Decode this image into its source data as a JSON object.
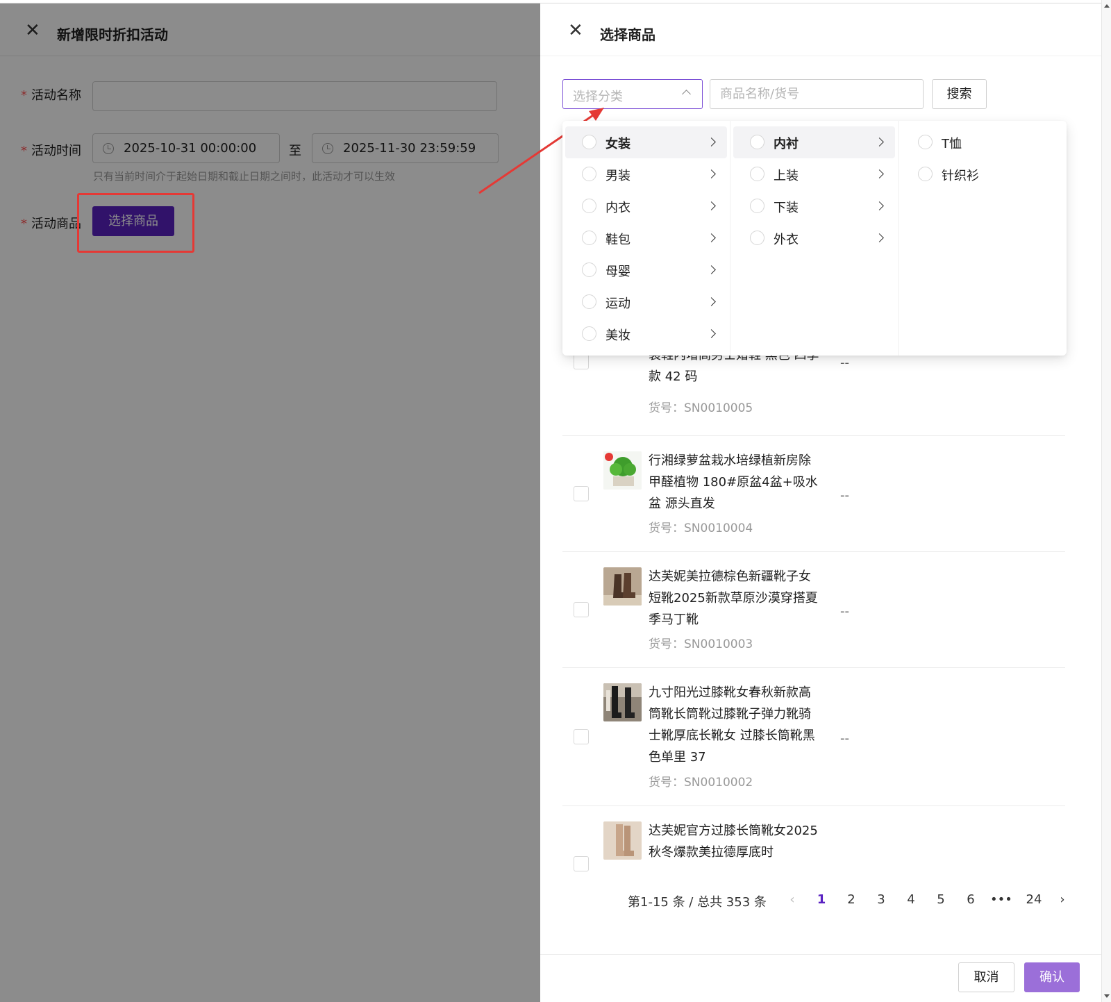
{
  "left_drawer": {
    "title": "新增限时折扣活动",
    "fields": {
      "name_label": "活动名称",
      "time_label": "活动时间",
      "start_time": "2025-10-31 00:00:00",
      "separator": "至",
      "end_time": "2025-11-30 23:59:59",
      "time_hint": "只有当前时间介于起始日期和截止日期之间时，此活动才可以生效",
      "product_label": "活动商品",
      "select_product_button": "选择商品"
    }
  },
  "right_drawer": {
    "title": "选择商品",
    "category_placeholder": "选择分类",
    "search_placeholder": "商品名称/货号",
    "search_button": "搜索",
    "cascader": {
      "level1": [
        "女装",
        "男装",
        "内衣",
        "鞋包",
        "母婴",
        "运动",
        "美妆"
      ],
      "level1_active": 0,
      "level2": [
        "内衬",
        "上装",
        "下装",
        "外衣"
      ],
      "level2_active": 0,
      "level3": [
        "T恤",
        "针织衫"
      ]
    },
    "products": [
      {
        "name": "装鞋内增高男士婚鞋 黑色 四季款 42 码",
        "sku": "货号：SN0010005",
        "price": "--"
      },
      {
        "name": "行湘绿萝盆栽水培绿植新房除甲醛植物 180#原盆4盆+吸水盆 源头直发",
        "sku": "货号：SN0010004",
        "price": "--"
      },
      {
        "name": "达芙妮美拉德棕色新疆靴子女短靴2025新款草原沙漠穿搭夏季马丁靴",
        "sku": "货号：SN0010003",
        "price": "--"
      },
      {
        "name": "九寸阳光过膝靴女春秋新款高筒靴长筒靴过膝靴子弹力靴骑士靴厚底长靴女 过膝长筒靴黑色单里 37",
        "sku": "货号：SN0010002",
        "price": "--"
      },
      {
        "name": "达芙妮官方过膝长筒靴女2025秋冬爆款美拉德厚底时",
        "sku": "",
        "price": ""
      }
    ],
    "pagination": {
      "summary": "第1-15 条 / 总共 353 条",
      "pages": [
        "1",
        "2",
        "3",
        "4",
        "5",
        "6",
        "•••",
        "24"
      ],
      "current": "1"
    },
    "footer": {
      "cancel": "取消",
      "confirm": "确认"
    }
  },
  "colors": {
    "primary": "#5a22c2",
    "confirm": "#9b6fd9",
    "highlight": "#e53935",
    "mask": "rgba(0,0,0,0.45)"
  }
}
